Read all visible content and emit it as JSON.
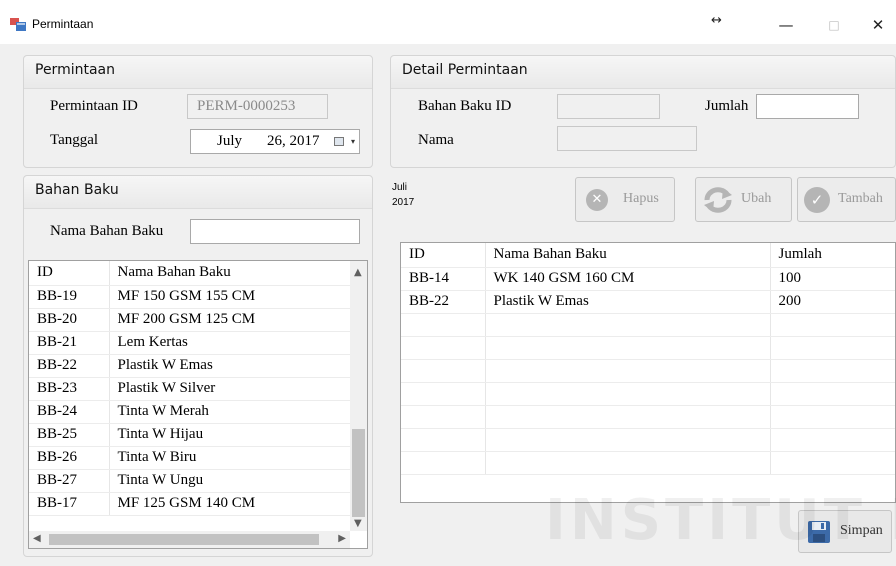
{
  "window": {
    "title": "Permintaan",
    "resize_glyph": "↔",
    "minimize": "—",
    "maximize": "□",
    "close": "✕"
  },
  "permintaan_group": {
    "title": "Permintaan",
    "id_label": "Permintaan ID",
    "id_value": "PERM-0000253",
    "date_label": "Tanggal",
    "date_month": "July",
    "date_day_year": "26, 2017",
    "calendar_dropdown_arrow": "▾"
  },
  "bahan_baku_group": {
    "title": "Bahan Baku",
    "name_label": "Nama Bahan Baku",
    "name_value": ""
  },
  "detail_group": {
    "title": "Detail Permintaan",
    "bahan_baku_id_label": "Bahan Baku ID",
    "bahan_baku_id_value": "",
    "jumlah_label": "Jumlah",
    "jumlah_value": "",
    "nama_label": "Nama",
    "nama_value": ""
  },
  "calendar_stamp": {
    "month": "Juli",
    "year": "2017"
  },
  "buttons": {
    "hapus": "Hapus",
    "ubah": "Ubah",
    "tambah": "Tambah",
    "simpan": "Simpan"
  },
  "icons": {
    "hapus": "delete-circle-icon",
    "ubah": "refresh-arrows-icon",
    "tambah": "check-circle-icon",
    "simpan": "floppy-disk-icon",
    "scroll_up": "▲",
    "scroll_down": "▼",
    "scroll_left": "◀",
    "scroll_right": "▶"
  },
  "bahan_grid": {
    "columns": [
      "ID",
      "Nama Bahan Baku"
    ],
    "rows": [
      [
        "BB-19",
        "MF 150 GSM 155 CM"
      ],
      [
        "BB-20",
        "MF 200 GSM 125 CM"
      ],
      [
        "BB-21",
        "Lem Kertas"
      ],
      [
        "BB-22",
        "Plastik W Emas"
      ],
      [
        "BB-23",
        "Plastik W Silver"
      ],
      [
        "BB-24",
        "Tinta W Merah"
      ],
      [
        "BB-25",
        "Tinta W Hijau"
      ],
      [
        "BB-26",
        "Tinta W Biru"
      ],
      [
        "BB-27",
        "Tinta W Ungu"
      ],
      [
        "BB-17",
        "MF 125 GSM 140 CM"
      ]
    ]
  },
  "detail_grid": {
    "columns": [
      "ID",
      "Nama Bahan Baku",
      "Jumlah"
    ],
    "rows": [
      [
        "BB-14",
        "WK 140 GSM 160 CM",
        "100"
      ],
      [
        "BB-22",
        "Plastik W Emas",
        "200"
      ]
    ]
  },
  "watermark": "INSTITUT BISN",
  "colors": {
    "window_bg": "#f0f0f0",
    "titlebar_bg": "#ffffff",
    "grid_bg": "#ffffff",
    "disabled_text": "#9a9a9a",
    "app_icon_red": "#d9534f",
    "app_icon_blue": "#3f78c4"
  }
}
